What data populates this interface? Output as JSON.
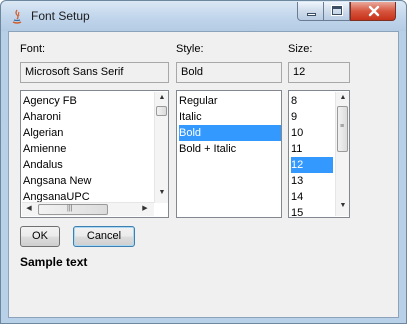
{
  "window": {
    "title": "Font Setup",
    "app_icon": "java-icon"
  },
  "title_buttons": {
    "minimize": "minimize-icon",
    "maximize": "maximize-icon",
    "close": "close-icon"
  },
  "font": {
    "label": "Font:",
    "value": "Microsoft Sans Serif",
    "items": [
      "Agency FB",
      "Aharoni",
      "Algerian",
      "Amienne",
      "Andalus",
      "Angsana New",
      "AngsanaUPC"
    ]
  },
  "style": {
    "label": "Style:",
    "value": "Bold",
    "items": [
      "Regular",
      "Italic",
      "Bold",
      "Bold + Italic"
    ],
    "selected": "Bold"
  },
  "size": {
    "label": "Size:",
    "value": "12",
    "items": [
      "8",
      "9",
      "10",
      "11",
      "12",
      "13",
      "14",
      "15"
    ],
    "selected": "12"
  },
  "buttons": {
    "ok": "OK",
    "cancel": "Cancel"
  },
  "sample_text": "Sample text",
  "colors": {
    "selection": "#3399ff",
    "titlebar": "#c3d7ec",
    "close_button": "#d7563f"
  }
}
